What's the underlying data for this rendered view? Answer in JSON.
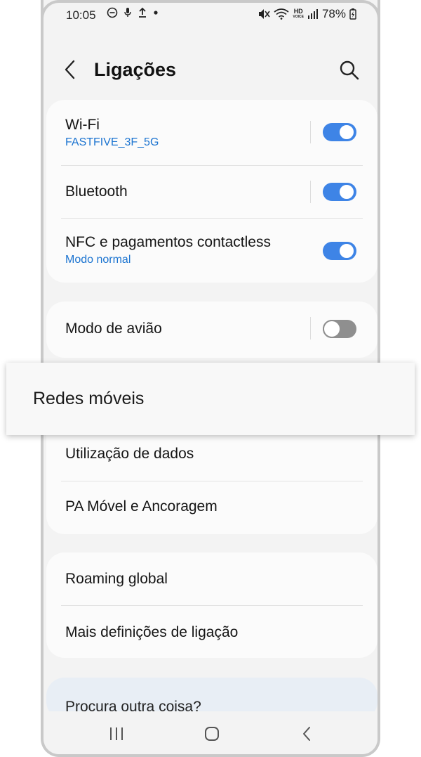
{
  "status_bar": {
    "time": "10:05",
    "battery": "78%",
    "hd_label": "HD",
    "voice_label": "VOICE"
  },
  "header": {
    "title": "Ligações"
  },
  "connections_card": {
    "items": [
      {
        "label": "Wi-Fi",
        "sublabel": "FASTFIVE_3F_5G",
        "toggle": "on"
      },
      {
        "label": "Bluetooth",
        "toggle": "on"
      },
      {
        "label": "NFC e pagamentos contactless",
        "sublabel": "Modo normal",
        "toggle": "on"
      }
    ]
  },
  "airplane_card": {
    "label": "Modo de avião",
    "toggle": "off"
  },
  "highlight": {
    "label": "Redes móveis"
  },
  "data_card": {
    "items": [
      {
        "label": "Utilização de dados"
      },
      {
        "label": "PA Móvel e Ancoragem"
      }
    ]
  },
  "more_card": {
    "items": [
      {
        "label": "Roaming global"
      },
      {
        "label": "Mais definições de ligação"
      }
    ]
  },
  "suggestion": {
    "label": "Procura outra coisa?"
  },
  "colors": {
    "accent": "#3e84e6",
    "link": "#1a73d0",
    "toggle_off": "#8f8f8f"
  },
  "icons": {
    "back": "chevron-left-icon",
    "search": "search-icon",
    "nav_recents": "recents-icon",
    "nav_home": "home-icon",
    "nav_back": "nav-back-icon"
  }
}
